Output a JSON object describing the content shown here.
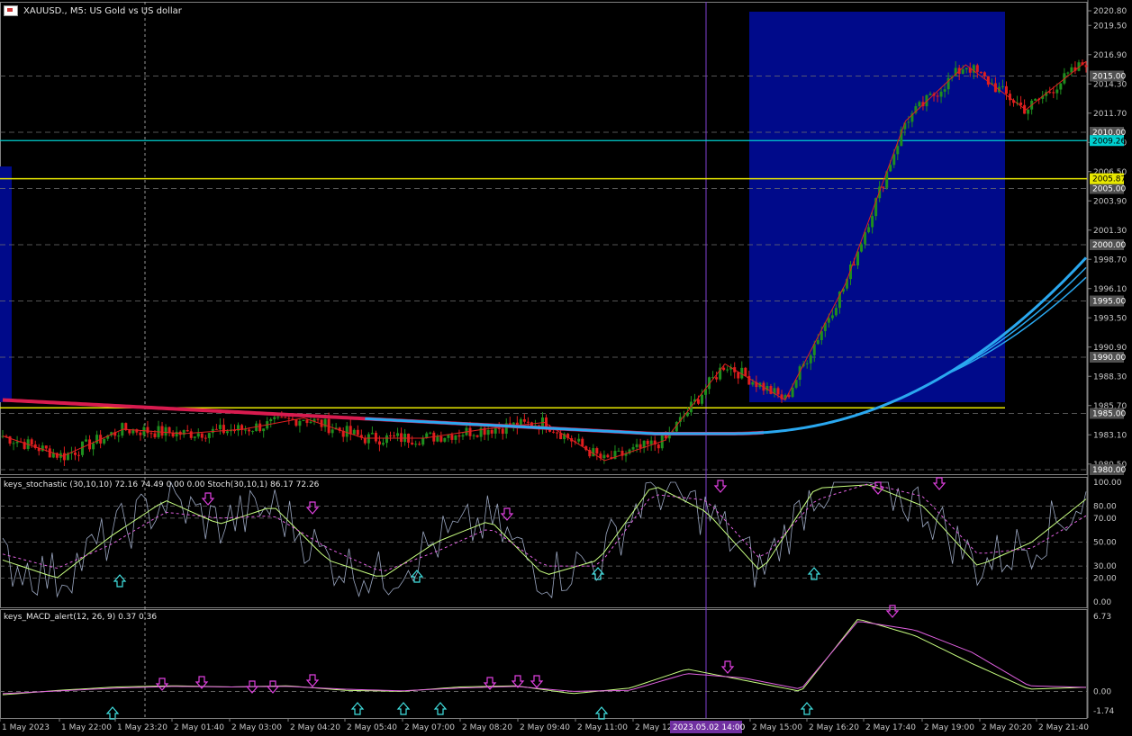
{
  "header": {
    "flag_icon": "us-flag-icon",
    "symbol_label": "XAUUSD., M5:  US Gold vs US dollar"
  },
  "main_pane": {
    "price_ticks": [
      "2020.80",
      "2019.50",
      "2016.90",
      "2014.30",
      "2011.70",
      "2009.10",
      "2006.50",
      "2003.90",
      "2001.30",
      "1998.70",
      "1996.10",
      "1993.50",
      "1990.90",
      "1988.30",
      "1985.70",
      "1983.10",
      "1980.50"
    ],
    "round_levels": [
      "2015.00",
      "2010.00",
      "2005.00",
      "2000.00",
      "1995.00",
      "1990.00",
      "1985.00",
      "1980.00"
    ],
    "marker_labels": [
      {
        "text": "2009.26",
        "color": "#00d0d0"
      },
      {
        "text": "2005.87",
        "color": "#e8e800"
      }
    ],
    "ylim": [
      1979.6,
      2021.6
    ],
    "colors": {
      "bull": "#1e8f1e",
      "bear": "#e01e1e",
      "zigzag": "#e02020",
      "ma_bear": "#d81b4f",
      "ma_bull": "#2aa8f0",
      "box": "#000a8a",
      "cyan_line": "#00d0d0",
      "yellow_line": "#e8e800",
      "vline": "#8040d0"
    }
  },
  "stoch_pane": {
    "label": "keys_stochastic (30,10,10) 72.16 74.49 0.00 0.00 Stoch(30,10,1) 86.17 72.26",
    "levels": [
      "100.00",
      "80.00",
      "70.00",
      "50.00",
      "30.00",
      "20.00",
      "0.00"
    ],
    "ylim": [
      0,
      100
    ]
  },
  "macd_pane": {
    "label": "keys_MACD_alert(12, 26, 9) 0.37 0.36",
    "levels": [
      "6.73",
      "0.00",
      "-1.74"
    ],
    "ylim": [
      -1.74,
      6.73
    ]
  },
  "time_axis": {
    "labels": [
      "1 May 2023",
      "1 May 22:00",
      "1 May 23:20",
      "2 May 01:40",
      "2 May 03:00",
      "2 May 04:20",
      "2 May 05:40",
      "2 May 07:00",
      "2 May 08:20",
      "2 May 09:40",
      "2 May 11:00",
      "2 May 12",
      "2 May 15:00",
      "2 May 16:20",
      "2 May 17:40",
      "2 May 19:00",
      "2 May 20:20",
      "2 May 21:40"
    ],
    "crosshair_label": "2023.05.02 14:00"
  },
  "chart_data": {
    "type": "candlestick",
    "symbol": "XAUUSD.",
    "timeframe": "M5",
    "key_points": {
      "x": [
        "1 May 2023",
        "1 May 22:00",
        "1 May 23:20",
        "2 May 01:40",
        "2 May 03:00",
        "2 May 04:20",
        "2 May 05:40",
        "2 May 07:00",
        "2 May 08:20",
        "2 May 09:40",
        "2 May 11:00",
        "2 May 12:20",
        "2 May 14:00",
        "2 May 15:00",
        "2 May 16:20",
        "2 May 17:40",
        "2 May 19:00",
        "2 May 20:20",
        "2 May 21:40"
      ],
      "close": [
        1983.0,
        1981.2,
        1983.6,
        1983.2,
        1983.6,
        1984.6,
        1982.8,
        1982.8,
        1983.6,
        1984.2,
        1980.8,
        1982.6,
        1989.4,
        1986.2,
        1996.5,
        2011.0,
        2016.0,
        2012.0,
        2016.3
      ]
    },
    "horizontal_lines": [
      2009.26,
      2005.87,
      1985.5
    ],
    "stochastic_main": [
      35,
      20,
      55,
      85,
      65,
      80,
      35,
      20,
      50,
      68,
      22,
      35,
      98,
      75,
      25,
      95,
      98,
      80,
      30,
      50,
      86
    ],
    "stochastic_signal": [
      40,
      28,
      48,
      75,
      70,
      72,
      45,
      25,
      42,
      62,
      30,
      30,
      90,
      85,
      35,
      85,
      99,
      88,
      40,
      45,
      72
    ],
    "macd_main": [
      -0.3,
      0.1,
      0.4,
      0.5,
      0.4,
      0.5,
      0.1,
      0.0,
      0.4,
      0.5,
      -0.2,
      0.3,
      2.0,
      1.0,
      0.0,
      6.5,
      5.0,
      2.5,
      0.2,
      0.37
    ],
    "macd_signal": [
      -0.2,
      0.05,
      0.3,
      0.45,
      0.4,
      0.45,
      0.2,
      0.05,
      0.3,
      0.45,
      0.0,
      0.1,
      1.6,
      1.2,
      0.2,
      6.3,
      5.5,
      3.5,
      0.5,
      0.36
    ]
  }
}
